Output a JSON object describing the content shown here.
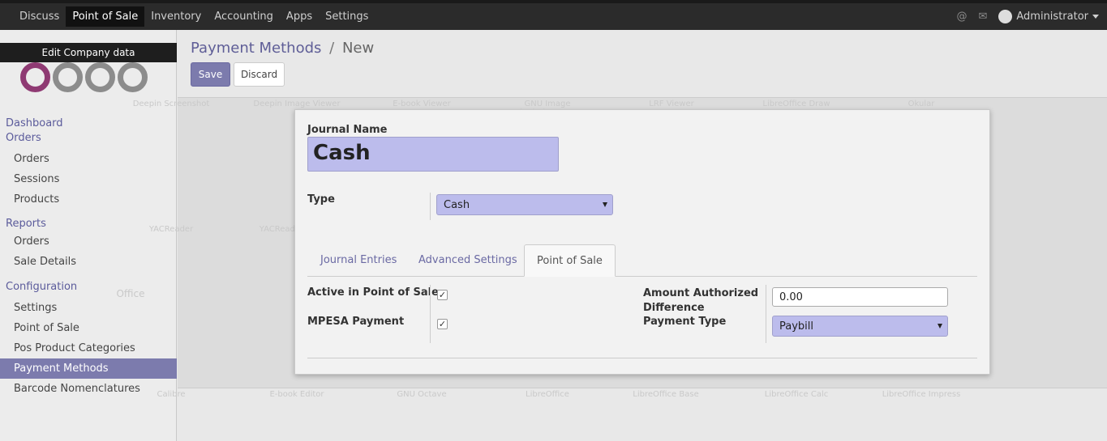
{
  "topbar": {
    "menu": [
      "Discuss",
      "Point of Sale",
      "Inventory",
      "Accounting",
      "Apps",
      "Settings"
    ],
    "active": "Point of Sale",
    "icons": [
      "at-icon",
      "chat-icon"
    ],
    "user": "Administrator"
  },
  "sidebar": {
    "tooltip": "Edit Company data",
    "logo_text": "odoo",
    "sections": [
      {
        "title": "Dashboard",
        "items": []
      },
      {
        "title": "Orders",
        "items": [
          "Orders",
          "Sessions",
          "Products"
        ]
      },
      {
        "title": "Reports",
        "items": [
          "Orders",
          "Sale Details"
        ]
      },
      {
        "title": "Configuration",
        "items": [
          "Settings",
          "Point of Sale",
          "Pos Product Categories",
          "Payment Methods",
          "Barcode Nomenclatures"
        ]
      }
    ],
    "active_item": "Payment Methods"
  },
  "header": {
    "breadcrumb_parent": "Payment Methods",
    "breadcrumb_sep": "/",
    "breadcrumb_current": "New",
    "save_label": "Save",
    "discard_label": "Discard"
  },
  "form": {
    "journal_name_label": "Journal Name",
    "journal_name_value": "Cash",
    "type_label": "Type",
    "type_value": "Cash",
    "tabs": [
      "Journal Entries",
      "Advanced Settings",
      "Point of Sale"
    ],
    "active_tab": "Point of Sale",
    "active_pos_label": "Active in Point of Sale",
    "active_pos_checked": true,
    "mpesa_label": "MPESA Payment",
    "mpesa_checked": true,
    "amount_label_1": "Amount Authorized",
    "amount_label_2": "Difference",
    "amount_value": "0.00",
    "payment_type_label": "Payment Type",
    "payment_type_value": "Paybill"
  },
  "background_desktop": {
    "labels": [
      "Deepin Screenshot",
      "Deepin Image Viewer",
      "E-book Viewer",
      "GNU Image Manipulation Program",
      "LRF Viewer",
      "LibreOffice Draw",
      "Okular",
      "YACReader",
      "YACReader Library",
      "Office",
      "Calibre",
      "E-book Editor",
      "GNU Octave",
      "LibreOffice",
      "LibreOffice Base",
      "LibreOffice Calc",
      "LibreOffice Impress"
    ]
  }
}
